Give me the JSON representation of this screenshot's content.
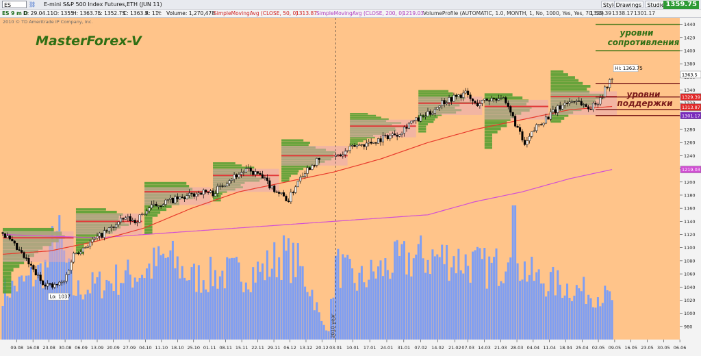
{
  "toolbar": {
    "symbol": "ES",
    "title": "E-mini S&P 500 Index Futures,ETH (JUN 11)",
    "style": "Style",
    "drawings": "Drawings",
    "studies": "Studies",
    "last_price": "1359.75"
  },
  "infobar": {
    "period": "ES 9 m D",
    "date": "D: 29.04.11",
    "open": "O: 1355",
    "high": "H: 1363.75",
    "low": "L: 1352.75",
    "close": "C: 1363.5",
    "range": "R: 11",
    "y": "Y:",
    "volume": "Volume: 1,270,478",
    "sma50": "SimpleMovingAvg (CLOSE, 50, 0)",
    "sma50_val": "1313.87",
    "sma200": "SimpleMovingAvg (CLOSE, 200, 0)",
    "sma200_val": "1219.03",
    "vp": "VolumeProfile (AUTOMATIC, 1.0, MONTH, 1, No, 1000, Yes, Yes, 70, 50)",
    "vp_vals": [
      "1329.39",
      "1338.17",
      "1301.17"
    ]
  },
  "copyright": "2010 © TD Ameritrade IP Company, Inc.",
  "watermark": "MasterForex-V",
  "annotations": {
    "resistance": [
      "уровни",
      "сопротивления"
    ],
    "support": [
      "уровни",
      "поддержки"
    ],
    "hi_label": "Hi: 1363.75",
    "lo_label": "Lo: 1037",
    "year_label": "2010 year"
  },
  "colors": {
    "background": "#ffc48a",
    "candle_bull": "#f4f4f4",
    "candle_bear": "#000000",
    "volume": "#7e9ef3",
    "sma50": "#e8392b",
    "sma200": "#d14fd4",
    "profile_green": "#57a032",
    "value_area_pink": "#e7a9b6",
    "poc_red": "#e23838",
    "resistance_line": "#4d7b1d",
    "support_line": "#7a1a1a"
  },
  "chart_data": {
    "type": "candlestick",
    "title": "E-mini S&P 500 Index Futures,ETH (JUN 11)",
    "timeframe": "daily",
    "ylim": [
      960,
      1450
    ],
    "y_ticks": [
      980,
      1000,
      1020,
      1040,
      1060,
      1080,
      1100,
      1120,
      1140,
      1160,
      1180,
      1200,
      1220,
      1240,
      1260,
      1280,
      1300,
      1320,
      1340,
      1360,
      1380,
      1400,
      1420,
      1440
    ],
    "x_ticks": [
      "09.08",
      "16.08",
      "23.08",
      "30.08",
      "06.09",
      "13.09",
      "20.09",
      "27.09",
      "04.10",
      "11.10",
      "18.10",
      "25.10",
      "01.11",
      "08.11",
      "15.11",
      "22.11",
      "29.11",
      "06.12",
      "13.12",
      "20.12",
      "03.01",
      "10.01",
      "17.01",
      "24.01",
      "31.01",
      "07.02",
      "14.02",
      "21.02",
      "07.03",
      "14.03",
      "21.03",
      "28.03",
      "04.04",
      "11.04",
      "18.04",
      "25.04",
      "02.05",
      "09.05",
      "16.05",
      "23.05",
      "30.05",
      "06.06"
    ],
    "price_path": [
      [
        0,
        1123
      ],
      [
        9,
        1085
      ],
      [
        16,
        1050
      ],
      [
        21,
        1040
      ],
      [
        26,
        1048
      ],
      [
        30,
        1090
      ],
      [
        38,
        1110
      ],
      [
        46,
        1130
      ],
      [
        52,
        1145
      ],
      [
        56,
        1140
      ],
      [
        62,
        1160
      ],
      [
        69,
        1170
      ],
      [
        76,
        1175
      ],
      [
        84,
        1185
      ],
      [
        89,
        1183
      ],
      [
        96,
        1205
      ],
      [
        103,
        1218
      ],
      [
        108,
        1212
      ],
      [
        113,
        1195
      ],
      [
        121,
        1172
      ],
      [
        126,
        1210
      ],
      [
        132,
        1230
      ],
      [
        138,
        1238
      ],
      [
        143,
        1240
      ],
      [
        149,
        1255
      ],
      [
        156,
        1260
      ],
      [
        163,
        1270
      ],
      [
        168,
        1275
      ],
      [
        172,
        1290
      ],
      [
        176,
        1295
      ],
      [
        181,
        1305
      ],
      [
        186,
        1322
      ],
      [
        192,
        1330
      ],
      [
        196,
        1335
      ],
      [
        200,
        1318
      ],
      [
        205,
        1325
      ],
      [
        211,
        1330
      ],
      [
        216,
        1298
      ],
      [
        221,
        1255
      ],
      [
        226,
        1285
      ],
      [
        231,
        1300
      ],
      [
        238,
        1320
      ],
      [
        243,
        1325
      ],
      [
        248,
        1312
      ],
      [
        251,
        1318
      ],
      [
        255,
        1340
      ],
      [
        258,
        1360
      ]
    ],
    "sma50_path": [
      [
        0,
        1090
      ],
      [
        20,
        1095
      ],
      [
        40,
        1110
      ],
      [
        60,
        1130
      ],
      [
        80,
        1160
      ],
      [
        100,
        1185
      ],
      [
        120,
        1200
      ],
      [
        140,
        1215
      ],
      [
        160,
        1235
      ],
      [
        180,
        1260
      ],
      [
        200,
        1280
      ],
      [
        220,
        1295
      ],
      [
        240,
        1310
      ],
      [
        258,
        1315
      ]
    ],
    "sma200_path": [
      [
        0,
        1120
      ],
      [
        40,
        1115
      ],
      [
        80,
        1125
      ],
      [
        120,
        1135
      ],
      [
        160,
        1145
      ],
      [
        180,
        1150
      ],
      [
        200,
        1170
      ],
      [
        220,
        1185
      ],
      [
        240,
        1205
      ],
      [
        258,
        1219
      ]
    ],
    "volume_path": [
      [
        0,
        0.35
      ],
      [
        10,
        0.42
      ],
      [
        20,
        0.55
      ],
      [
        22,
        0.85
      ],
      [
        30,
        0.35
      ],
      [
        40,
        0.4
      ],
      [
        60,
        0.5
      ],
      [
        70,
        0.6
      ],
      [
        80,
        0.45
      ],
      [
        95,
        0.48
      ],
      [
        110,
        0.5
      ],
      [
        118,
        0.62
      ],
      [
        125,
        0.55
      ],
      [
        131,
        0.35
      ],
      [
        135,
        0.12
      ],
      [
        138,
        0.08
      ],
      [
        141,
        0.55
      ],
      [
        150,
        0.42
      ],
      [
        165,
        0.55
      ],
      [
        175,
        0.6
      ],
      [
        190,
        0.6
      ],
      [
        205,
        0.52
      ],
      [
        212,
        0.55
      ],
      [
        216,
        0.95
      ],
      [
        219,
        0.55
      ],
      [
        225,
        0.45
      ],
      [
        240,
        0.38
      ],
      [
        258,
        0.3
      ]
    ],
    "volume_profiles": [
      {
        "start": 0,
        "end": 30,
        "low": 1030,
        "high": 1130,
        "poc": 1115,
        "va_low": 1078,
        "va_high": 1125
      },
      {
        "start": 31,
        "end": 59,
        "low": 1090,
        "high": 1160,
        "poc": 1140,
        "va_low": 1120,
        "va_high": 1152
      },
      {
        "start": 60,
        "end": 88,
        "low": 1120,
        "high": 1200,
        "poc": 1185,
        "va_low": 1165,
        "va_high": 1192
      },
      {
        "start": 89,
        "end": 117,
        "low": 1170,
        "high": 1230,
        "poc": 1210,
        "va_low": 1185,
        "va_high": 1220
      },
      {
        "start": 118,
        "end": 146,
        "low": 1200,
        "high": 1265,
        "poc": 1240,
        "va_low": 1225,
        "va_high": 1255
      },
      {
        "start": 147,
        "end": 175,
        "low": 1255,
        "high": 1305,
        "poc": 1285,
        "va_low": 1268,
        "va_high": 1295
      },
      {
        "start": 176,
        "end": 203,
        "low": 1275,
        "high": 1340,
        "poc": 1320,
        "va_low": 1302,
        "va_high": 1330
      },
      {
        "start": 204,
        "end": 231,
        "low": 1250,
        "high": 1335,
        "poc": 1315,
        "va_low": 1295,
        "va_high": 1325
      },
      {
        "start": 232,
        "end": 260,
        "low": 1290,
        "high": 1370,
        "poc": 1330,
        "va_low": 1302,
        "va_high": 1338
      }
    ],
    "resistance_levels": [
      1440,
      1400
    ],
    "support_levels": [
      1350,
      1329.39,
      1310,
      1301.17
    ],
    "price_labels": [
      {
        "value": "1363.5",
        "y": 1363.5,
        "color": "#ffffff",
        "text_color": "#000000"
      },
      {
        "value": "1329.39",
        "y": 1329.39,
        "color": "#e02828",
        "text_color": "#ffffff"
      },
      {
        "value": "1313.87",
        "y": 1313.87,
        "color": "#e02828",
        "text_color": "#ffffff"
      },
      {
        "value": "1301.17",
        "y": 1301.17,
        "color": "#7a2bbd",
        "text_color": "#ffffff"
      },
      {
        "value": "1219.03",
        "y": 1219.03,
        "color": "#d14fd4",
        "text_color": "#ffffff"
      }
    ],
    "hi": 1363.75,
    "lo": 1037
  }
}
